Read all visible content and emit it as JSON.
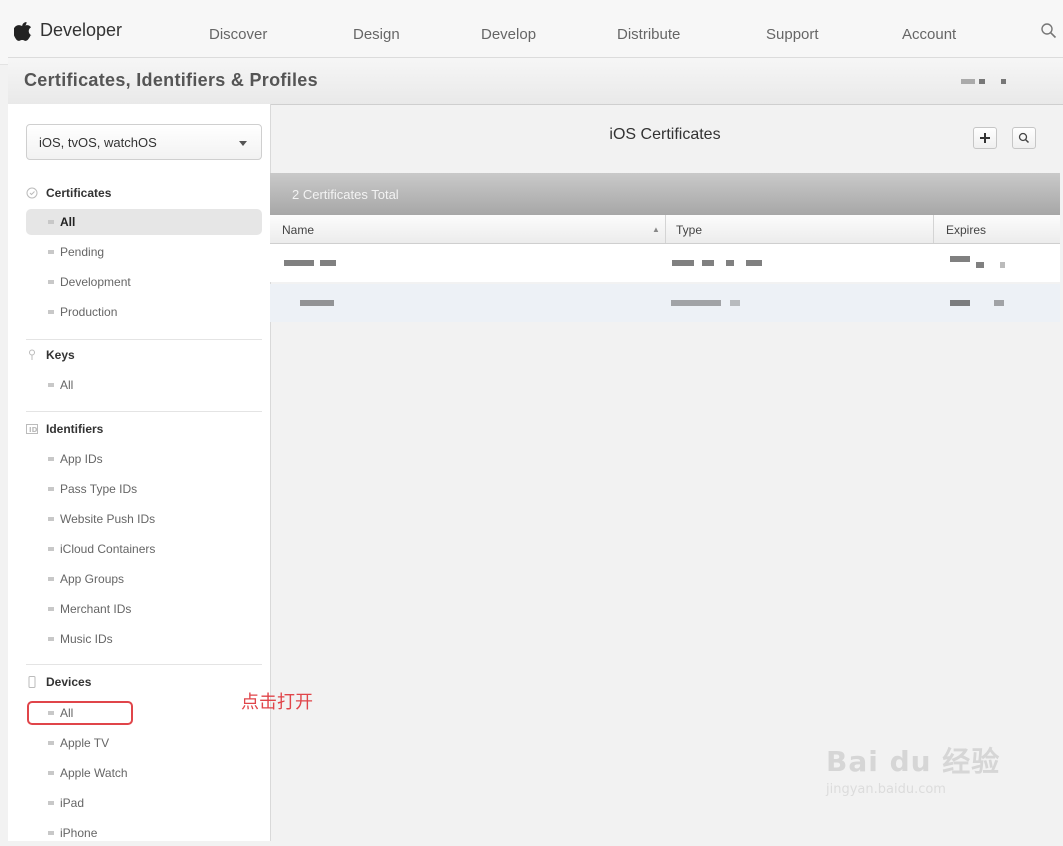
{
  "nav": {
    "brand": "Developer",
    "links": [
      "Discover",
      "Design",
      "Develop",
      "Distribute",
      "Support",
      "Account"
    ]
  },
  "titlebar": {
    "title": "Certificates, Identifiers & Profiles"
  },
  "sidebar": {
    "platform": "iOS, tvOS, watchOS",
    "sections": [
      {
        "title": "Certificates",
        "items": [
          "All",
          "Pending",
          "Development",
          "Production"
        ]
      },
      {
        "title": "Keys",
        "items": [
          "All"
        ]
      },
      {
        "title": "Identifiers",
        "items": [
          "App IDs",
          "Pass Type IDs",
          "Website Push IDs",
          "iCloud Containers",
          "App Groups",
          "Merchant IDs",
          "Music IDs"
        ]
      },
      {
        "title": "Devices",
        "items": [
          "All",
          "Apple TV",
          "Apple Watch",
          "iPad",
          "iPhone"
        ]
      }
    ]
  },
  "annotation": "点击打开",
  "main": {
    "title": "iOS Certificates",
    "total": "2 Certificates Total",
    "columns": [
      "Name",
      "Type",
      "Expires"
    ]
  },
  "watermark": {
    "main": "Bai du 经验",
    "sub": "jingyan.baidu.com"
  },
  "colors": {
    "highlight": "#e0454a",
    "selected_bg": "#e6e6e6"
  }
}
